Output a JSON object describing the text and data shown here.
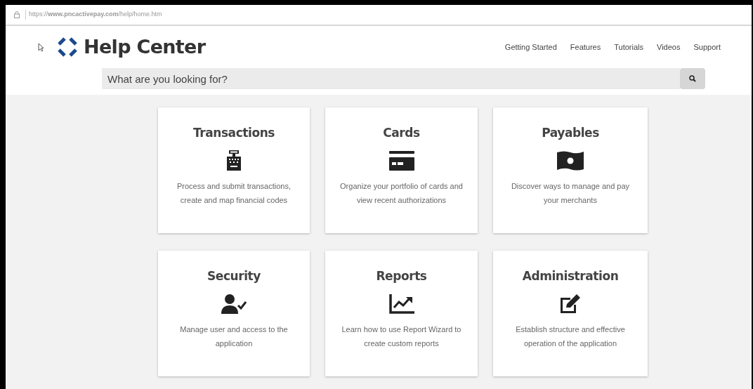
{
  "address_bar": {
    "url": "https://**www.pncactivepay.com**/help/home.htm"
  },
  "header": {
    "title": "Help Center",
    "nav": [
      {
        "label": "Getting Started"
      },
      {
        "label": "Features"
      },
      {
        "label": "Tutorials"
      },
      {
        "label": "Videos"
      },
      {
        "label": "Support"
      }
    ]
  },
  "search": {
    "placeholder": "What are you looking for?"
  },
  "cards": [
    {
      "kind": "register",
      "title": "Transactions",
      "description": "Process and submit transactions, create and map financial codes"
    },
    {
      "kind": "card",
      "title": "Cards",
      "description": "Organize your portfolio of cards and view recent authorizations"
    },
    {
      "kind": "money",
      "title": "Payables",
      "description": "Discover ways to manage and pay your merchants"
    },
    {
      "kind": "user",
      "title": "Security",
      "description": "Manage user and access to the application"
    },
    {
      "kind": "chart",
      "title": "Reports",
      "description": "Learn how to use Report Wizard to create custom reports"
    },
    {
      "kind": "edit",
      "title": "Administration",
      "description": "Establish structure and effective operation of the application"
    }
  ]
}
